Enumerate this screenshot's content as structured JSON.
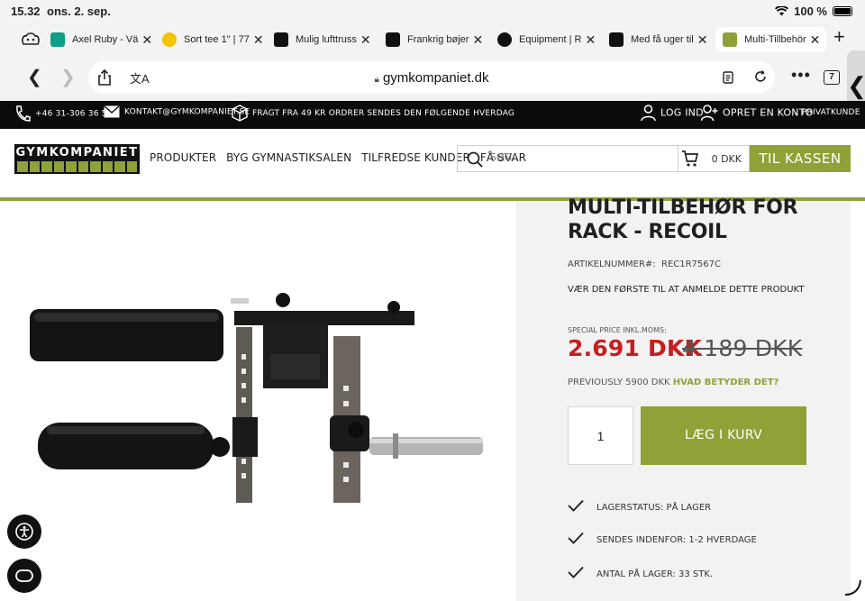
{
  "status_bar": {
    "time": "15.32",
    "date": "ons. 2. sep.",
    "battery": "100 %"
  },
  "tabs": [
    {
      "title": "Axel Ruby - Vä",
      "color": "#0f9e86"
    },
    {
      "title": "Sort tee 1\" | 77",
      "color": "#f2c300"
    },
    {
      "title": "Mulig lufttruss",
      "color": "#111111"
    },
    {
      "title": "Frankrig bøjer",
      "color": "#111111"
    },
    {
      "title": "Equipment | R",
      "color": "#111111"
    },
    {
      "title": "Med få uger til",
      "color": "#111111"
    },
    {
      "title": "Multi-Tillbehör",
      "color": "#8ea238"
    }
  ],
  "browser": {
    "url": "gymkompaniet.dk",
    "tab_count": "7"
  },
  "topbar": {
    "phone": "+46 31-306 36 51",
    "email": "KONTAKT@GYMKOMPANIET.SE",
    "shipping": "FRAGT FRA 49 KR ORDRER SENDES DEN FØLGENDE HVERDAG",
    "login": "LOG IND",
    "register": "OPRET EN KONTO",
    "customer_type": "PRIVATKUNDE"
  },
  "header": {
    "logo_text": "GYMKOMPANIET",
    "nav": [
      "PRODUKTER",
      "BYG GYMNASTIKSALEN",
      "TILFREDSE KUNDER",
      "FÅ SVAR"
    ],
    "search_placeholder": "SØG...",
    "cart_amount": "0 DKK",
    "checkout_label": "TIL KASSEN"
  },
  "product": {
    "title": "MULTI-TILBEHØR FOR RACK - RECOIL",
    "sku_label": "ARTIKELNUMMER#:",
    "sku": "REC1R7567C",
    "review_prompt": "VÆR DEN FØRSTE TIL AT ANMELDE DETTE PRODUKT",
    "price_label": "SPECIAL PRICE INKL.MOMS:",
    "price": "2.691 DKK",
    "old_price": "4.189 DKK",
    "previously": "PREVIOUSLY 5900 DKK",
    "previously_link": "HVAD BETYDER DET?",
    "quantity": "1",
    "add_to_cart": "LÆG I KURV",
    "stock": [
      "LAGERSTATUS: PÅ LAGER",
      "SENDES INDENFOR: 1-2 HVERDAGE",
      "ANTAL PÅ LAGER: 33 STK."
    ]
  },
  "colors": {
    "accent": "#8ea238",
    "sale": "#c61e1e",
    "topbar": "#0b0b0b"
  }
}
